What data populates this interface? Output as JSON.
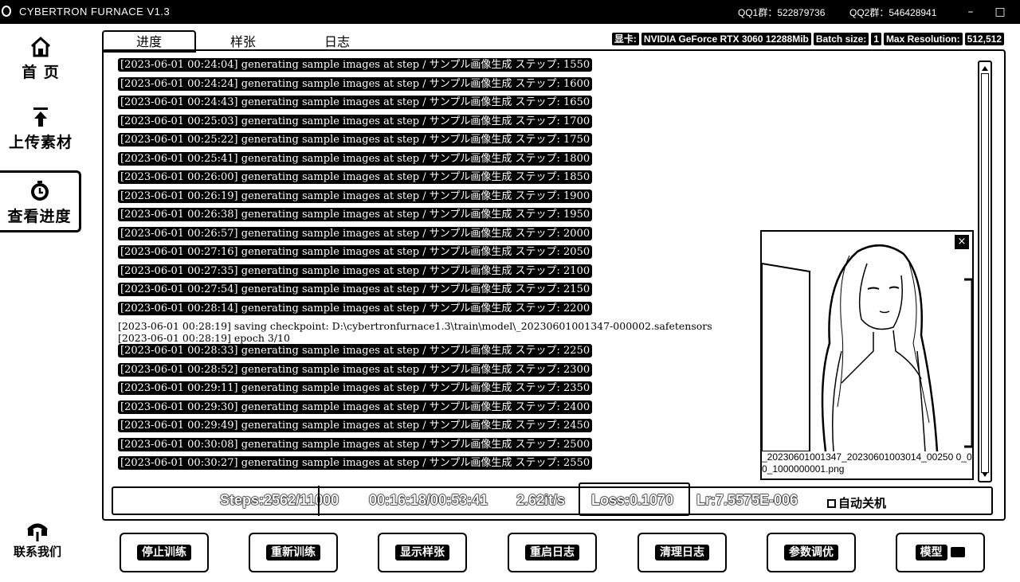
{
  "window": {
    "title": "CYBERTRON FURNACE V1.3",
    "qq1": "QQ1群：522879736",
    "qq2": "QQ2群：546428941",
    "minimize": "–",
    "maximize": "□"
  },
  "sidebar": {
    "items": [
      {
        "label": "首 页",
        "icon": "home-icon"
      },
      {
        "label": "上传素材",
        "icon": "upload-icon"
      },
      {
        "label": "查看进度",
        "icon": "progress-icon"
      }
    ],
    "contact": {
      "label": "联系我们",
      "icon": "contact-icon"
    }
  },
  "tabs": [
    "进度",
    "样张",
    "日志"
  ],
  "gpu": {
    "label": "显卡:",
    "name": "NVIDIA GeForce RTX 3060 12288Mib",
    "batch_label": "Batch size:",
    "batch_value": "1",
    "res_label": "Max Resolution:",
    "res_value": "512,512"
  },
  "log": [
    "[2023-06-01 00:24:04] generating sample images at step / サンプル画像生成 ステップ: 1550",
    "[2023-06-01 00:24:24] generating sample images at step / サンプル画像生成 ステップ: 1600",
    "[2023-06-01 00:24:43] generating sample images at step / サンプル画像生成 ステップ: 1650",
    "[2023-06-01 00:25:03] generating sample images at step / サンプル画像生成 ステップ: 1700",
    "[2023-06-01 00:25:22] generating sample images at step / サンプル画像生成 ステップ: 1750",
    "[2023-06-01 00:25:41] generating sample images at step / サンプル画像生成 ステップ: 1800",
    "[2023-06-01 00:26:00] generating sample images at step / サンプル画像生成 ステップ: 1850",
    "[2023-06-01 00:26:19] generating sample images at step / サンプル画像生成 ステップ: 1900",
    "[2023-06-01 00:26:38] generating sample images at step / サンプル画像生成 ステップ: 1950",
    "[2023-06-01 00:26:57] generating sample images at step / サンプル画像生成 ステップ: 2000",
    "[2023-06-01 00:27:16] generating sample images at step / サンプル画像生成 ステップ: 2050",
    "[2023-06-01 00:27:35] generating sample images at step / サンプル画像生成 ステップ: 2100",
    "[2023-06-01 00:27:54] generating sample images at step / サンプル画像生成 ステップ: 2150",
    "[2023-06-01 00:28:14] generating sample images at step / サンプル画像生成 ステップ: 2200"
  ],
  "log_plain": [
    "[2023-06-01 00:28:19] saving checkpoint: D:\\cybertronfurnace1.3\\train\\model\\_20230601001347-000002.safetensors",
    "[2023-06-01 00:28:19] epoch 3/10"
  ],
  "log2": [
    "[2023-06-01 00:28:33] generating sample images at step / サンプル画像生成 ステップ: 2250",
    "[2023-06-01 00:28:52] generating sample images at step / サンプル画像生成 ステップ: 2300",
    "[2023-06-01 00:29:11] generating sample images at step / サンプル画像生成 ステップ: 2350",
    "[2023-06-01 00:29:30] generating sample images at step / サンプル画像生成 ステップ: 2400",
    "[2023-06-01 00:29:49] generating sample images at step / サンプル画像生成 ステップ: 2450",
    "[2023-06-01 00:30:08] generating sample images at step / サンプル画像生成 ステップ: 2500",
    "[2023-06-01 00:30:27] generating sample images at step / サンプル画像生成 ステップ: 2550"
  ],
  "preview": {
    "close": "×",
    "caption": "_20230601001347_20230601003014_00250 0_00_1000000001.png"
  },
  "status": {
    "steps": "Steps:2562/11000",
    "time": "00:16:18/00:53:41",
    "speed": "2.62it/s",
    "loss": "Loss:0.1070",
    "lr": "Lr:7.5575E-006",
    "auto_shutdown": "自动关机"
  },
  "buttons": [
    "停止训练",
    "重新训练",
    "显示样张",
    "重启日志",
    "清理日志",
    "参数调优",
    "模型"
  ]
}
